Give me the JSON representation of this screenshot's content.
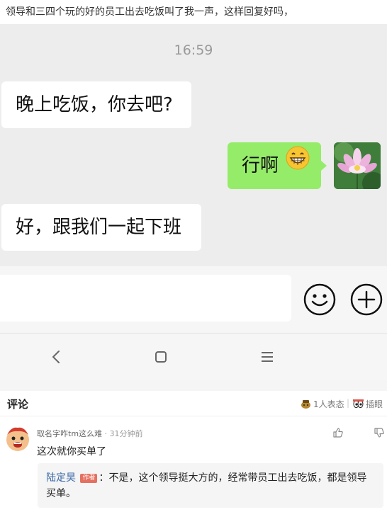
{
  "post": {
    "title": "领导和三四个玩的好的员工出去吃饭叫了我一声，这样回复好吗，"
  },
  "chat": {
    "time": "16:59",
    "messages": [
      {
        "side": "left",
        "text": "晚上吃饭，你去吧?"
      },
      {
        "side": "right",
        "text": "行啊",
        "emoji": "grin-emoji"
      },
      {
        "side": "left",
        "text": "好，跟我们一起下班"
      }
    ],
    "my_avatar": "lotus-flower-avatar"
  },
  "input_bar": {
    "icons": [
      "smiley-face-icon",
      "plus-circle-icon"
    ]
  },
  "nav_bar": {
    "icons": [
      "back-chevron-icon",
      "home-square-icon",
      "menu-lines-icon"
    ]
  },
  "comments": {
    "title": "评论",
    "reactions": "1人表态",
    "images_label": "插眼",
    "items": [
      {
        "user": "取名字咋tm这么难",
        "time": "· 31分钟前",
        "text": "这次就你买单了",
        "reply": {
          "user": "陆定昊",
          "badge": "作者",
          "text": "：不是，这个领导挺大方的，经常带员工出去吃饭，都是领导买单。"
        }
      }
    ]
  },
  "colors": {
    "chat_bg": "#ededed",
    "my_bubble": "#95ec69",
    "their_bubble": "#ffffff",
    "link_blue": "#3b6aa8",
    "badge_red": "#e5705f"
  }
}
